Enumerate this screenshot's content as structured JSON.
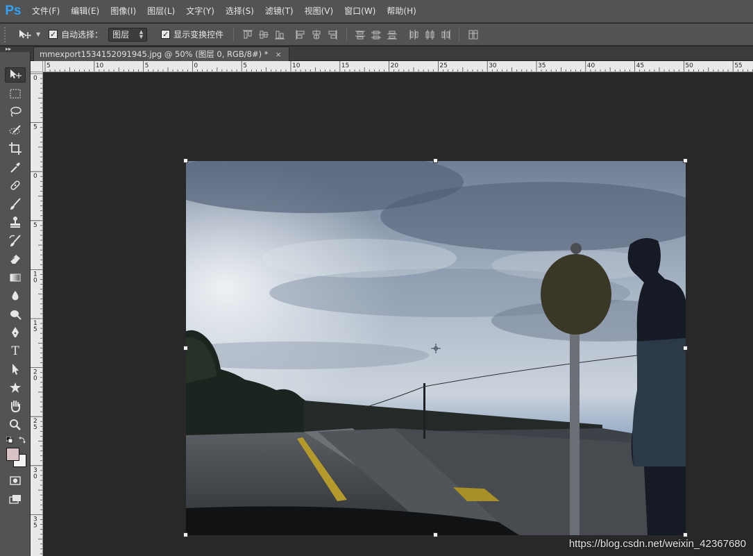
{
  "app": {
    "logo": "Ps",
    "menu": [
      "文件(F)",
      "编辑(E)",
      "图像(I)",
      "图层(L)",
      "文字(Y)",
      "选择(S)",
      "滤镜(T)",
      "视图(V)",
      "窗口(W)",
      "帮助(H)"
    ]
  },
  "options": {
    "tool_icon": "move-tool-icon",
    "auto_select_label": "自动选择：",
    "auto_select_checked": true,
    "auto_select_target": "图层",
    "show_transform_label": "显示变换控件",
    "show_transform_checked": true
  },
  "document": {
    "tab_title": "mmexport1534152091945.jpg @ 50% (图层 0, RGB/8#) *",
    "close_glyph": "×"
  },
  "rulers": {
    "horizontal_labels": [
      "5",
      "10",
      "5",
      "0",
      "5",
      "10",
      "15",
      "20",
      "25",
      "30",
      "35",
      "40",
      "45",
      "50",
      "55"
    ],
    "vertical_labels": [
      "0",
      "5",
      "0",
      "5",
      "1\n0",
      "1\n5",
      "2\n0",
      "2\n5",
      "3\n0",
      "3\n5"
    ]
  },
  "tools": [
    "move-tool",
    "marquee-tool",
    "lasso-tool",
    "quick-select-tool",
    "crop-tool",
    "eyedropper-tool",
    "healing-brush-tool",
    "brush-tool",
    "clone-stamp-tool",
    "history-brush-tool",
    "eraser-tool",
    "gradient-tool",
    "blur-tool",
    "dodge-tool",
    "pen-tool",
    "type-tool",
    "path-select-tool",
    "shape-tool",
    "hand-tool",
    "zoom-tool"
  ],
  "type_tool_glyph": "T",
  "colors": {
    "foreground": "#d9c2c4",
    "background": "#f3f3f3",
    "accent": "#2fa3f5"
  },
  "watermark": "https://blog.csdn.net/weixin_42367680"
}
